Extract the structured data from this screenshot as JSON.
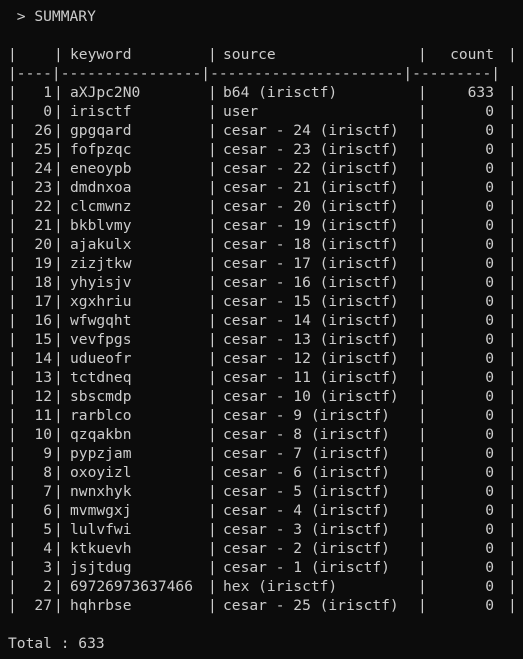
{
  "header": {
    "prompt": " > SUMMARY"
  },
  "table": {
    "columns": {
      "num": "",
      "keyword": "keyword",
      "source": "source",
      "count": "count"
    },
    "separator": "|----|----------------|----------------------|---------|",
    "rows": [
      {
        "num": "1",
        "keyword": "aXJpc2N0",
        "source": "b64 (irisctf)",
        "count": "633"
      },
      {
        "num": "0",
        "keyword": "irisctf",
        "source": "user",
        "count": "0"
      },
      {
        "num": "26",
        "keyword": "gpgqard",
        "source": "cesar - 24 (irisctf)",
        "count": "0"
      },
      {
        "num": "25",
        "keyword": "fofpzqc",
        "source": "cesar - 23 (irisctf)",
        "count": "0"
      },
      {
        "num": "24",
        "keyword": "eneoypb",
        "source": "cesar - 22 (irisctf)",
        "count": "0"
      },
      {
        "num": "23",
        "keyword": "dmdnxoa",
        "source": "cesar - 21 (irisctf)",
        "count": "0"
      },
      {
        "num": "22",
        "keyword": "clcmwnz",
        "source": "cesar - 20 (irisctf)",
        "count": "0"
      },
      {
        "num": "21",
        "keyword": "bkblvmy",
        "source": "cesar - 19 (irisctf)",
        "count": "0"
      },
      {
        "num": "20",
        "keyword": "ajakulx",
        "source": "cesar - 18 (irisctf)",
        "count": "0"
      },
      {
        "num": "19",
        "keyword": "zizjtkw",
        "source": "cesar - 17 (irisctf)",
        "count": "0"
      },
      {
        "num": "18",
        "keyword": "yhyisjv",
        "source": "cesar - 16 (irisctf)",
        "count": "0"
      },
      {
        "num": "17",
        "keyword": "xgxhriu",
        "source": "cesar - 15 (irisctf)",
        "count": "0"
      },
      {
        "num": "16",
        "keyword": "wfwgqht",
        "source": "cesar - 14 (irisctf)",
        "count": "0"
      },
      {
        "num": "15",
        "keyword": "vevfpgs",
        "source": "cesar - 13 (irisctf)",
        "count": "0"
      },
      {
        "num": "14",
        "keyword": "udueofr",
        "source": "cesar - 12 (irisctf)",
        "count": "0"
      },
      {
        "num": "13",
        "keyword": "tctdneq",
        "source": "cesar - 11 (irisctf)",
        "count": "0"
      },
      {
        "num": "12",
        "keyword": "sbscmdp",
        "source": "cesar - 10 (irisctf)",
        "count": "0"
      },
      {
        "num": "11",
        "keyword": "rarblco",
        "source": "cesar - 9 (irisctf)",
        "count": "0"
      },
      {
        "num": "10",
        "keyword": "qzqakbn",
        "source": "cesar - 8 (irisctf)",
        "count": "0"
      },
      {
        "num": "9",
        "keyword": "pypzjam",
        "source": "cesar - 7 (irisctf)",
        "count": "0"
      },
      {
        "num": "8",
        "keyword": "oxoyizl",
        "source": "cesar - 6 (irisctf)",
        "count": "0"
      },
      {
        "num": "7",
        "keyword": "nwnxhyk",
        "source": "cesar - 5 (irisctf)",
        "count": "0"
      },
      {
        "num": "6",
        "keyword": "mvmwgxj",
        "source": "cesar - 4 (irisctf)",
        "count": "0"
      },
      {
        "num": "5",
        "keyword": "lulvfwi",
        "source": "cesar - 3 (irisctf)",
        "count": "0"
      },
      {
        "num": "4",
        "keyword": "ktkuevh",
        "source": "cesar - 2 (irisctf)",
        "count": "0"
      },
      {
        "num": "3",
        "keyword": "jsjtdug",
        "source": "cesar - 1 (irisctf)",
        "count": "0"
      },
      {
        "num": "2",
        "keyword": "69726973637466",
        "source": "hex (irisctf)",
        "count": "0"
      },
      {
        "num": "27",
        "keyword": "hqhrbse",
        "source": "cesar - 25 (irisctf)",
        "count": "0"
      }
    ]
  },
  "footer": {
    "total": "Total : 633"
  }
}
